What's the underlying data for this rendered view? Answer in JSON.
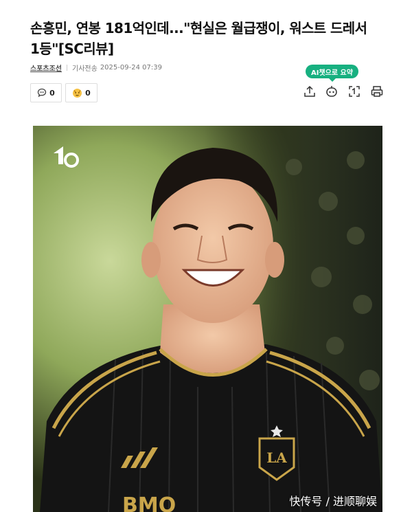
{
  "article": {
    "title_line1": "손흥민, 연봉 181억인데...\"현실은 월급쟁이, 워스트 드레서",
    "title_line2": "1등\"[SC리뷰]",
    "press": "스포츠조선",
    "sent_label": "기사전송",
    "sent_time": "2025-09-24 07:39"
  },
  "reactions": {
    "comment_count": "0",
    "like_count": "0"
  },
  "toolbar": {
    "ai_summary_label": "AI챗으로 요약",
    "icons": [
      "share-icon",
      "ai-bot-icon",
      "scan-icon",
      "print-icon"
    ]
  },
  "photo": {
    "logo_text": "1",
    "watermark": "快传号 / 进顺聊娱",
    "sponsor_text": "BMO"
  },
  "colors": {
    "accent_green": "#17b080",
    "jersey_black": "#141414",
    "jersey_gold": "#c9a54a"
  }
}
